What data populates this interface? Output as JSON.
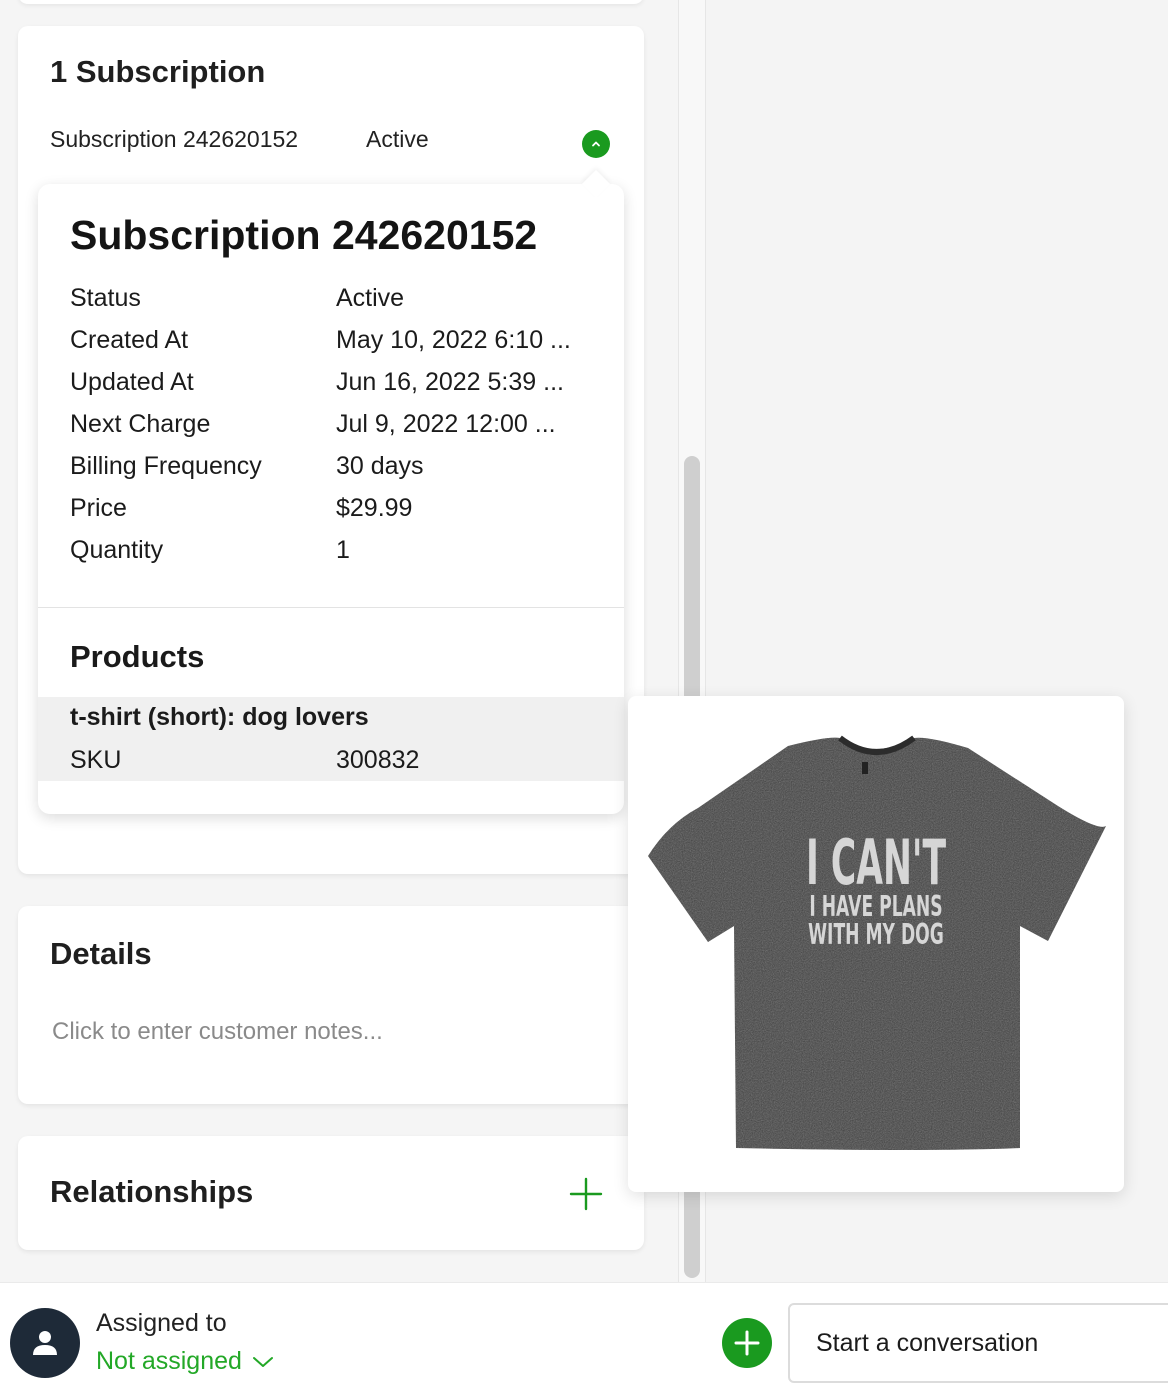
{
  "subscriptions_card": {
    "title": "1 Subscription",
    "row": {
      "name": "Subscription 242620152",
      "status": "Active"
    }
  },
  "subscription_popover": {
    "title": "Subscription 242620152",
    "fields": [
      {
        "label": "Status",
        "value": "Active"
      },
      {
        "label": "Created At",
        "value": "May 10, 2022 6:10 ..."
      },
      {
        "label": "Updated At",
        "value": "Jun 16, 2022 5:39 ..."
      },
      {
        "label": "Next Charge",
        "value": "Jul 9, 2022 12:00 ..."
      },
      {
        "label": "Billing Frequency",
        "value": "30 days"
      },
      {
        "label": "Price",
        "value": "$29.99"
      },
      {
        "label": "Quantity",
        "value": "1"
      }
    ],
    "products_title": "Products",
    "product": {
      "name": "t-shirt (short): dog lovers",
      "sku_label": "SKU",
      "sku_value": "300832"
    }
  },
  "product_image": {
    "shirt_text": [
      "I CAN'T",
      "I HAVE PLANS",
      "WITH MY DOG"
    ],
    "shirt_color": "#3f3f3f"
  },
  "details_card": {
    "title": "Details",
    "notes_placeholder": "Click to enter customer notes..."
  },
  "relationships_card": {
    "title": "Relationships",
    "add_icon": "plus-icon"
  },
  "footer": {
    "assigned_label": "Assigned to",
    "assigned_value": "Not assigned",
    "conversation_placeholder": "Start a conversation"
  },
  "colors": {
    "accent_green": "#1a9a1f",
    "link_green": "#23a827",
    "avatar_bg": "#1e2a38"
  }
}
